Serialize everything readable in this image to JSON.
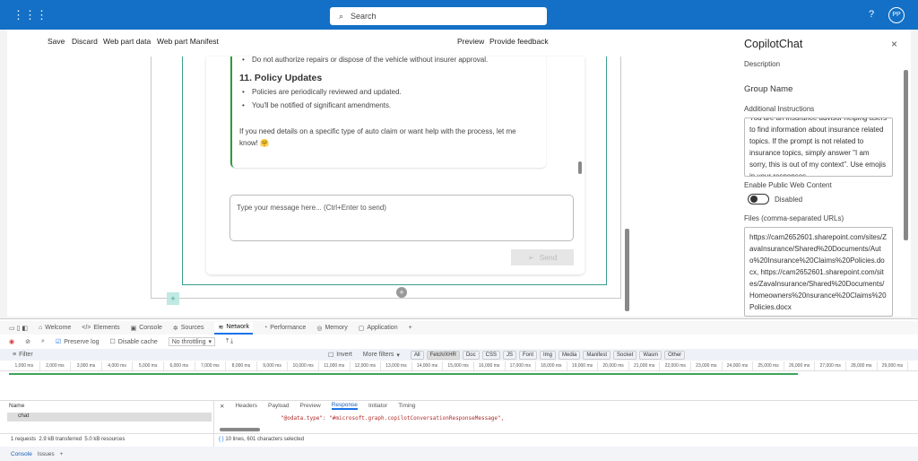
{
  "topbar": {
    "search_placeholder": "Search",
    "help": "?",
    "avatar": "PP",
    "brand_color": "#1370c6"
  },
  "toolbar": {
    "save": "Save",
    "discard": "Discard",
    "web_part_data": "Web part data",
    "web_part_manifest": "Web part Manifest",
    "preview": "Preview",
    "feedback": "Provide feedback"
  },
  "chat": {
    "truncated_bullet": "Do not authorize repairs or dispose of the vehicle without insurer approval.",
    "heading": "11. Policy Updates",
    "bullets": [
      "Policies are periodically reviewed and updated.",
      "You'll be notified of significant amendments."
    ],
    "closing": "If you need details on a specific type of auto claim or want help with the process, let me know! 🤗",
    "input_placeholder": "Type your message here... (Ctrl+Enter to send)",
    "send": "Send"
  },
  "panel": {
    "title": "CopilotChat",
    "description_label": "Description",
    "group_name": "Group Name",
    "additional_label": "Additional Instructions",
    "additional_value": "You are an insurance advisor helping users to find information about insurance related topics. If the prompt is not related to insurance topics, simply answer \"I am sorry, this is out of my context\". Use emojis in your responses.",
    "web_label": "Enable Public Web Content",
    "web_state": "Disabled",
    "files_label": "Files (comma-separated URLs)",
    "files_value": "https://cam2652601.sharepoint.com/sites/ZavaInsurance/Shared%20Documents/Auto%20Insurance%20Claims%20Policies.docx, https://cam2652601.sharepoint.com/sites/ZavaInsurance/Shared%20Documents/Homeowners%20nsurance%20Claims%20Policies.docx"
  },
  "devtools": {
    "tabs": [
      "Welcome",
      "Elements",
      "Console",
      "Sources",
      "Network",
      "Performance",
      "Memory",
      "Application"
    ],
    "preserve_log": "Preserve log",
    "disable_cache": "Disable cache",
    "throttling": "No throttling",
    "filter": "Filter",
    "invert": "Invert",
    "more_filters": "More filters",
    "types": [
      "All",
      "Fetch/XHR",
      "Doc",
      "CSS",
      "JS",
      "Font",
      "Img",
      "Media",
      "Manifest",
      "Socket",
      "Wasm",
      "Other"
    ],
    "ticks": [
      "1,000 ms",
      "2,000 ms",
      "3,000 ms",
      "4,000 ms",
      "5,000 ms",
      "6,000 ms",
      "7,000 ms",
      "8,000 ms",
      "9,000 ms",
      "10,000 ms",
      "11,000 ms",
      "12,000 ms",
      "13,000 ms",
      "14,000 ms",
      "15,000 ms",
      "16,000 ms",
      "17,000 ms",
      "18,000 ms",
      "19,000 ms",
      "20,000 ms",
      "21,000 ms",
      "22,000 ms",
      "23,000 ms",
      "24,000 ms",
      "25,000 ms",
      "26,000 ms",
      "27,000 ms",
      "28,000 ms",
      "29,000 ms"
    ],
    "name_header": "Name",
    "request": "chat",
    "detail_tabs": [
      "Headers",
      "Payload",
      "Preview",
      "Response",
      "Initiator",
      "Timing"
    ],
    "response_line": "\"@odata.type\": \"#microsoft.graph.copilotConversationResponseMessage\",",
    "summary": "1 requests  2.9 kB transferred  5.0 kB resources",
    "selection": "10 lines, 601 characters selected",
    "drawer_tabs": [
      "Console",
      "Issues"
    ]
  }
}
